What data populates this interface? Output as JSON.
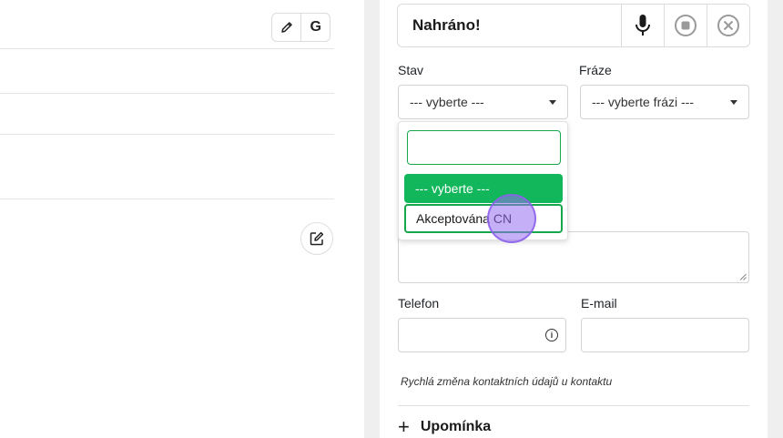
{
  "left": {
    "toolbar": {
      "edit_icon": "pencil-icon",
      "google_letter": "G"
    },
    "edit_button_icon": "edit-square-icon"
  },
  "recorder": {
    "status": "Nahráno!",
    "icons": [
      "microphone-icon",
      "stop-icon",
      "close-icon"
    ]
  },
  "form": {
    "stav_label": "Stav",
    "stav_value": "--- vyberte ---",
    "fraze_label": "Fráze",
    "fraze_value": "--- vyberte frázi ---",
    "dropdown": {
      "search_value": "",
      "options": [
        "--- vyberte ---",
        "Akceptována CN"
      ],
      "selected_index": 0
    },
    "telefon_label": "Telefon",
    "telefon_value": "",
    "email_label": "E-mail",
    "email_value": "",
    "note": "Rychlá změna kontaktních údajů u kontaktu",
    "reminder_label": "Upomínka"
  },
  "colors": {
    "accent_green": "#11b75a",
    "cursor_purple": "#966ef0"
  }
}
